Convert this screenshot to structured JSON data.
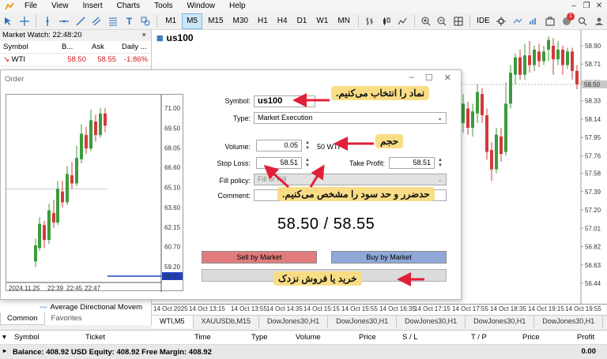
{
  "menu": [
    "File",
    "View",
    "Insert",
    "Charts",
    "Tools",
    "Window",
    "Help"
  ],
  "toolbar": {
    "timeframes": [
      "M1",
      "M5",
      "M15",
      "M30",
      "H1",
      "H4",
      "D1",
      "W1",
      "MN"
    ],
    "active_timeframe": "M5",
    "ide_label": "IDE",
    "notification_count": "1"
  },
  "market_watch": {
    "title": "Market Watch: 22:48:20",
    "close": "×",
    "columns": [
      "Symbol",
      "B...",
      "Ask",
      "Daily ..."
    ],
    "rows": [
      {
        "symbol": "WTI",
        "bid": "58.50",
        "ask": "58.55",
        "change": "-1.86%"
      }
    ]
  },
  "chart": {
    "symbol": "us100",
    "y_ticks": [
      "58.90",
      "58.71",
      "58.52",
      "58.33",
      "58.14",
      "57.95",
      "57.76",
      "57.58",
      "57.39",
      "57.20",
      "57.01",
      "56.82",
      "56.63",
      "56.44"
    ],
    "current_price": "58.50",
    "x_labels": [
      "14 Oct 2025",
      "14 Oct 13:15",
      "14 Oct 13:55",
      "14 Oct 14:35",
      "14 Oct 15:15",
      "14 Oct 15:55",
      "14 Oct 16:35",
      "14 Oct 17:15",
      "14 Oct 17:55",
      "14 Oct 18:35",
      "14 Oct 19:15",
      "14 Oct 19:55"
    ],
    "tabs": [
      "WTI,M5",
      "XAUUSDb,M15",
      "DowJones30,H1",
      "DowJones30,H1",
      "DowJones30,H1",
      "DowJones30,H1",
      "DowJones30,H1",
      "Do"
    ]
  },
  "navigator": {
    "item": "Average Directional Movem",
    "tabs": [
      "Common",
      "Favorites"
    ]
  },
  "order": {
    "title": "Order",
    "symbol_label": "Symbol:",
    "symbol_value": "us100",
    "type_label": "Type:",
    "type_value": "Market Execution",
    "volume_label": "Volume:",
    "volume_value": "0.05",
    "volume_hint": "50 WTI",
    "sl_label": "Stop Loss:",
    "sl_value": "58.51",
    "tp_label": "Take Profit:",
    "tp_value": "58.51",
    "fill_label": "Fill policy:",
    "fill_value": "Fill or Kill",
    "comment_label": "Comment:",
    "comment_value": "",
    "price_display": "58.50 / 58.55",
    "sell_label": "Sell by Market",
    "buy_label": "Buy by Market",
    "mini_chart": {
      "y_ticks": [
        "71.00",
        "69.50",
        "68.05",
        "66.60",
        "65.10",
        "63.60",
        "62.15",
        "60.70",
        "59.20",
        "58.51"
      ],
      "x_labels": [
        "2024.11.25",
        "22:39",
        "22:45",
        "22:47"
      ]
    }
  },
  "annotations": {
    "symbol_note": "نماد را انتخاب می‌کنیم.",
    "volume_note": "حجم",
    "sltp_note": "حدضرر و حد سود را مشخص می‌کنیم.",
    "trade_note": "خرید یا فروش نزدک"
  },
  "terminal": {
    "columns": [
      "Symbol",
      "Ticket",
      "Time",
      "Type",
      "Volume",
      "Price",
      "S / L",
      "T / P",
      "Price",
      "Profit"
    ],
    "balance_line": "Balance: 408.92 USD  Equity: 408.92  Free Margin: 408.92",
    "total_profit": "0.00"
  },
  "colors": {
    "bull": "#3c9b3c",
    "bear": "#d23a3a",
    "note_bg": "#f9dd86",
    "arrow": "#e0203a",
    "sell": "#e27c7c",
    "buy": "#8fa8d8"
  }
}
